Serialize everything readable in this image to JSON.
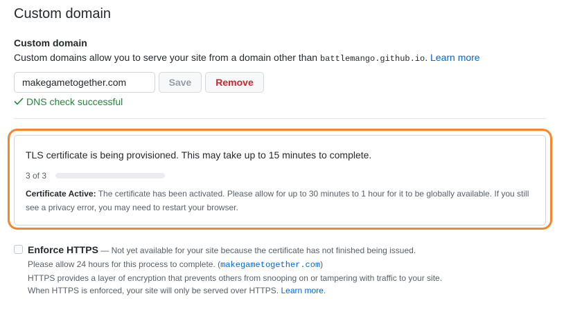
{
  "section_title": "Custom domain",
  "custom_domain": {
    "heading": "Custom domain",
    "description": "Custom domains allow you to serve your site from a domain other than ",
    "default_domain": "battlemango.github.io",
    "period": ".",
    "learn_more": "Learn more",
    "input_value": "makegametogether.com",
    "save_label": "Save",
    "remove_label": "Remove",
    "dns_icon": "check-icon",
    "dns_status": "DNS check successful"
  },
  "tls": {
    "message": "TLS certificate is being provisioned. This may take up to 15 minutes to complete.",
    "step": "3 of 3",
    "progress_fraction": 0,
    "status_label": "Certificate Active:",
    "status_text": " The certificate has been activated. Please allow for up to 30 minutes to 1 hour for it to be globally available. If you still see a privacy error, you may need to restart your browser."
  },
  "https": {
    "label": "Enforce HTTPS",
    "unavailable": " — Not yet available for your site because the certificate has not finished being issued.",
    "allow_text": "Please allow 24 hours for this process to complete. (",
    "domain": "makegametogether.com",
    "close_paren": ")",
    "desc1": "HTTPS provides a layer of encryption that prevents others from snooping on or tampering with traffic to your site.",
    "desc2": "When HTTPS is enforced, your site will only be served over HTTPS. ",
    "learn_more": "Learn more",
    "period": "."
  },
  "colors": {
    "accent": "#0366d6",
    "success": "#22863a",
    "danger": "#cb2431",
    "highlight": "#f7852b"
  }
}
